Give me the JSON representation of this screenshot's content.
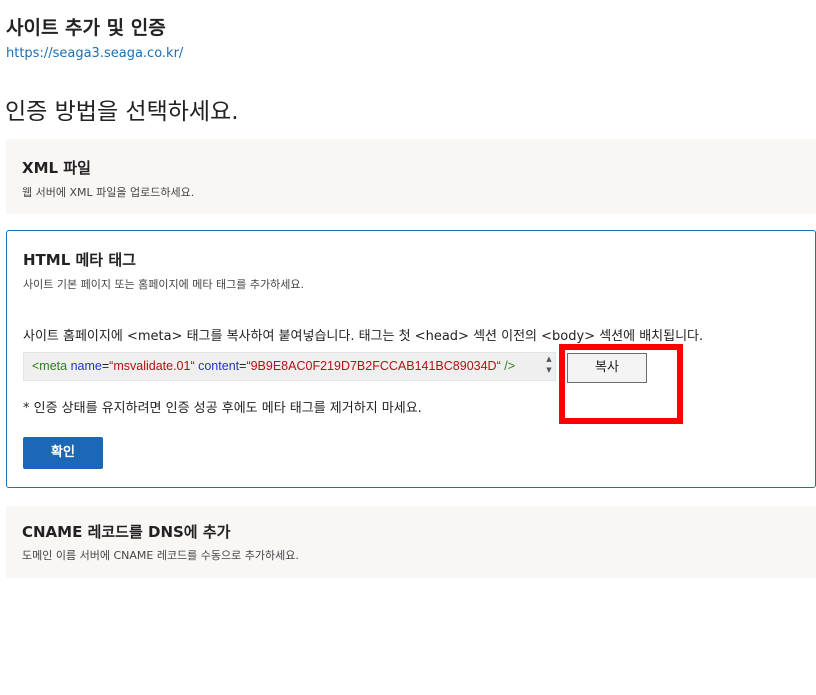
{
  "header": {
    "title": "사이트 추가 및 인증",
    "site_url": "https://seaga3.seaga.co.kr/"
  },
  "main": {
    "heading": "인증 방법을 선택하세요."
  },
  "methods": {
    "xml": {
      "title": "XML 파일",
      "description": "웹 서버에 XML 파일을 업로드하세요."
    },
    "html_meta": {
      "title": "HTML 메타 태그",
      "description": "사이트 기본 페이지 또는 홈페이지에 메타 태그를 추가하세요.",
      "instruction": "사이트 홈페이지에 <meta> 태그를 복사하여 붙여넣습니다. 태그는 첫 <head> 섹션 이전의 <body> 섹션에 배치됩니다.",
      "meta_tag": {
        "open": "<meta",
        "name_attr": "name",
        "name_value": "“msvalidate.01“",
        "content_attr": "content",
        "content_value": "“9B9E8AC0F219D7B2FCCAB141BC89034D“",
        "close": "/>"
      },
      "copy_label": "복사",
      "note": "* 인증 상태를 유지하려면 인증 성공 후에도 메타 태그를 제거하지 마세요.",
      "confirm_label": "확인"
    },
    "cname": {
      "title": "CNAME 레코드를 DNS에 추가",
      "description": "도메인 이름 서버에 CNAME 레코드를 수동으로 추가하세요."
    }
  },
  "colors": {
    "link": "#1a6fb5",
    "accent": "#1c68b7",
    "highlight": "#ff0000"
  }
}
